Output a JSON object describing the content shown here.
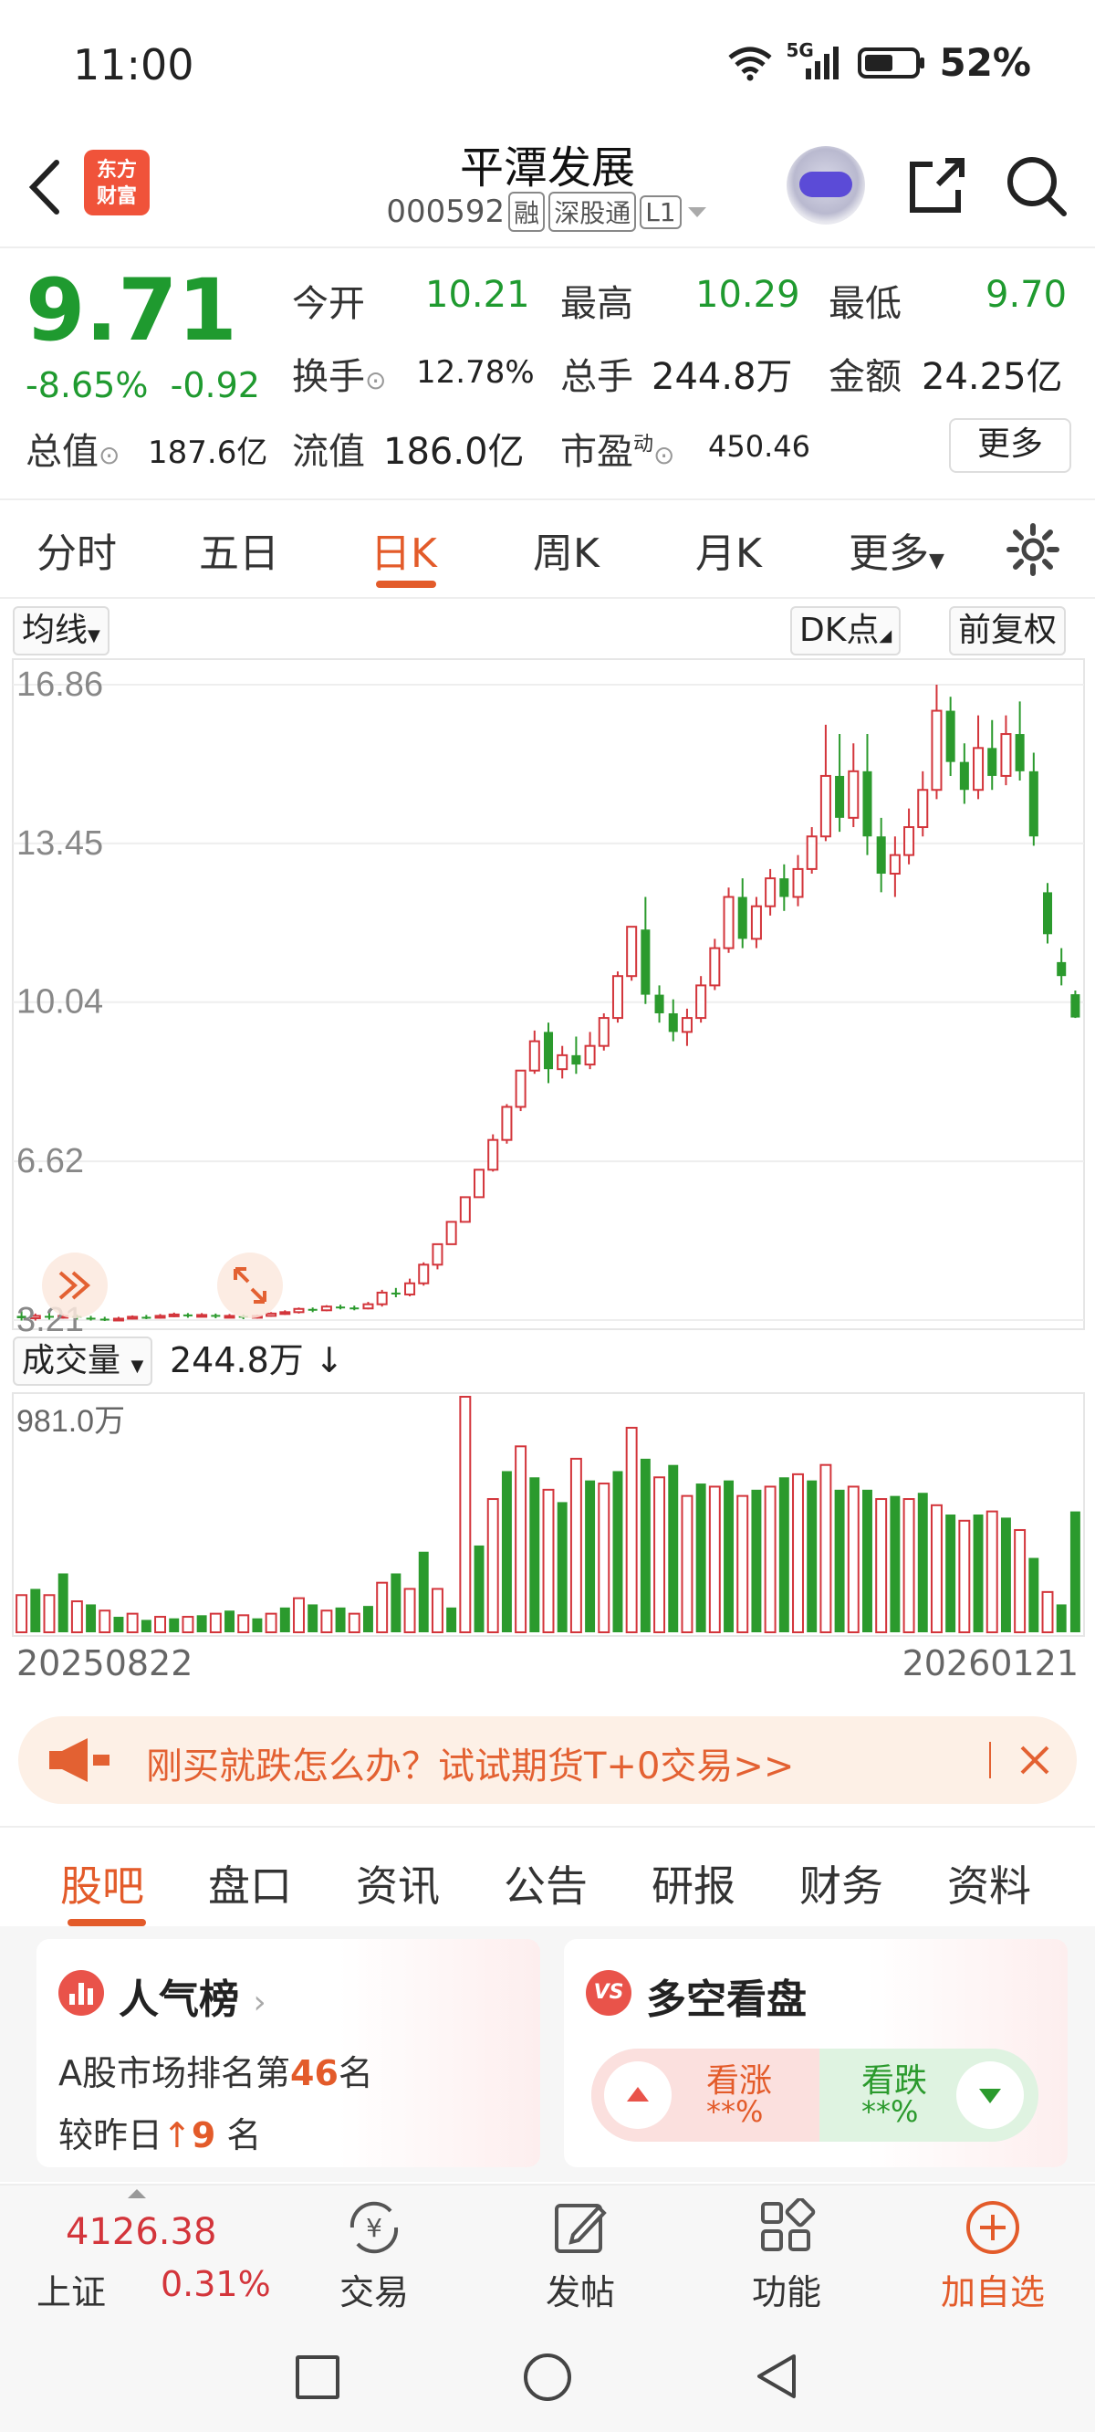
{
  "status_bar": {
    "time": "11:00",
    "network": "5G",
    "battery": "52%"
  },
  "header": {
    "logo_line1": "东方",
    "logo_line2": "财富",
    "title": "平潭发展",
    "code": "000592",
    "tags": [
      "融",
      "深股通",
      "L1"
    ]
  },
  "quote": {
    "price": "9.71",
    "change_pct": "-8.65%",
    "change_abs": "-0.92",
    "open_label": "今开",
    "open": "10.21",
    "high_label": "最高",
    "high": "10.29",
    "low_label": "最低",
    "low": "9.70",
    "turnover_label": "换手",
    "turnover": "12.78%",
    "volume_label": "总手",
    "volume": "244.8万",
    "amount_label": "金额",
    "amount": "24.25亿",
    "mktcap_label": "总值",
    "mktcap": "187.6亿",
    "float_label": "流值",
    "float": "186.0亿",
    "pe_label": "市盈",
    "pe_sup": "动",
    "pe": "450.46",
    "more": "更多"
  },
  "period_tabs": [
    "分时",
    "五日",
    "日K",
    "周K",
    "月K",
    "更多"
  ],
  "active_period": "日K",
  "chart_options": {
    "ma": "均线",
    "dk": "DK点",
    "adjust": "前复权",
    "volume_label": "成交量",
    "volume_value": "244.8万 ↓"
  },
  "colors": {
    "up": "#d3353b",
    "down": "#2b9a2d",
    "accent": "#e35b2a"
  },
  "chart_data": [
    {
      "type": "candlestick",
      "title": "",
      "y_ticks": [
        "16.86",
        "13.45",
        "10.04",
        "6.62",
        "3.21"
      ],
      "ylim": [
        3.21,
        16.86
      ],
      "x_start": "20250822",
      "x_end": "20260121",
      "candles": [
        [
          3.3,
          3.25,
          3.4,
          3.2
        ],
        [
          3.25,
          3.3,
          3.35,
          3.2
        ],
        [
          3.3,
          3.28,
          3.36,
          3.22
        ],
        [
          3.28,
          3.3,
          3.34,
          3.24
        ],
        [
          3.3,
          3.26,
          3.33,
          3.22
        ],
        [
          3.26,
          3.24,
          3.3,
          3.2
        ],
        [
          3.24,
          3.22,
          3.28,
          3.19
        ],
        [
          3.22,
          3.24,
          3.28,
          3.2
        ],
        [
          3.24,
          3.28,
          3.31,
          3.22
        ],
        [
          3.28,
          3.26,
          3.32,
          3.23
        ],
        [
          3.26,
          3.3,
          3.34,
          3.24
        ],
        [
          3.3,
          3.33,
          3.37,
          3.27
        ],
        [
          3.33,
          3.3,
          3.36,
          3.26
        ],
        [
          3.3,
          3.32,
          3.36,
          3.27
        ],
        [
          3.32,
          3.29,
          3.35,
          3.25
        ],
        [
          3.29,
          3.3,
          3.34,
          3.26
        ],
        [
          3.3,
          3.27,
          3.33,
          3.23
        ],
        [
          3.27,
          3.3,
          3.33,
          3.24
        ],
        [
          3.3,
          3.35,
          3.38,
          3.28
        ],
        [
          3.35,
          3.38,
          3.42,
          3.32
        ],
        [
          3.38,
          3.45,
          3.48,
          3.35
        ],
        [
          3.45,
          3.42,
          3.48,
          3.38
        ],
        [
          3.42,
          3.5,
          3.53,
          3.4
        ],
        [
          3.5,
          3.48,
          3.54,
          3.44
        ],
        [
          3.48,
          3.46,
          3.52,
          3.42
        ],
        [
          3.46,
          3.55,
          3.6,
          3.44
        ],
        [
          3.55,
          3.8,
          3.86,
          3.5
        ],
        [
          3.8,
          3.76,
          3.9,
          3.7
        ],
        [
          3.76,
          4.0,
          4.1,
          3.72
        ],
        [
          4.0,
          4.4,
          4.45,
          3.95
        ],
        [
          4.4,
          4.84,
          4.84,
          4.3
        ],
        [
          4.84,
          5.32,
          5.32,
          4.84
        ],
        [
          5.32,
          5.85,
          5.85,
          5.32
        ],
        [
          5.85,
          6.44,
          6.44,
          5.85
        ],
        [
          6.44,
          7.08,
          7.2,
          6.4
        ],
        [
          7.08,
          7.79,
          7.85,
          7.0
        ],
        [
          7.79,
          8.57,
          8.57,
          7.7
        ],
        [
          8.57,
          9.2,
          9.43,
          8.5
        ],
        [
          9.4,
          8.6,
          9.6,
          8.3
        ],
        [
          8.6,
          8.9,
          9.1,
          8.4
        ],
        [
          8.9,
          8.7,
          9.3,
          8.5
        ],
        [
          8.7,
          9.1,
          9.4,
          8.6
        ],
        [
          9.1,
          9.7,
          9.8,
          9.0
        ],
        [
          9.7,
          10.6,
          10.7,
          9.6
        ],
        [
          10.6,
          11.66,
          11.66,
          10.5
        ],
        [
          11.6,
          10.2,
          12.3,
          10.0
        ],
        [
          10.2,
          9.8,
          10.4,
          9.6
        ],
        [
          9.8,
          9.4,
          10.1,
          9.2
        ],
        [
          9.4,
          9.7,
          9.9,
          9.1
        ],
        [
          9.7,
          10.4,
          10.6,
          9.6
        ],
        [
          10.4,
          11.2,
          11.4,
          10.3
        ],
        [
          11.2,
          12.3,
          12.5,
          11.1
        ],
        [
          12.3,
          11.4,
          12.7,
          11.2
        ],
        [
          11.4,
          12.1,
          12.3,
          11.2
        ],
        [
          12.1,
          12.7,
          12.9,
          11.9
        ],
        [
          12.7,
          12.3,
          13.0,
          12.0
        ],
        [
          12.3,
          12.9,
          13.2,
          12.1
        ],
        [
          12.9,
          13.6,
          13.8,
          12.8
        ],
        [
          13.6,
          14.9,
          16.0,
          13.5
        ],
        [
          14.9,
          14.0,
          15.8,
          13.7
        ],
        [
          14.0,
          15.0,
          15.6,
          13.8
        ],
        [
          15.0,
          13.6,
          15.8,
          13.2
        ],
        [
          13.6,
          12.8,
          14.0,
          12.4
        ],
        [
          12.8,
          13.2,
          13.6,
          12.3
        ],
        [
          13.2,
          13.8,
          14.2,
          13.0
        ],
        [
          13.8,
          14.6,
          15.0,
          13.6
        ],
        [
          14.6,
          16.3,
          16.86,
          14.4
        ],
        [
          16.3,
          15.2,
          16.6,
          14.9
        ],
        [
          15.2,
          14.6,
          15.6,
          14.3
        ],
        [
          14.6,
          15.5,
          16.2,
          14.4
        ],
        [
          15.5,
          14.9,
          16.1,
          14.6
        ],
        [
          14.9,
          15.8,
          16.2,
          14.7
        ],
        [
          15.8,
          15.0,
          16.5,
          14.8
        ],
        [
          15.0,
          13.6,
          15.4,
          13.4
        ],
        [
          12.4,
          11.5,
          12.6,
          11.3
        ],
        [
          10.9,
          10.6,
          11.2,
          10.4
        ],
        [
          10.21,
          9.71,
          10.29,
          9.7
        ]
      ],
      "volume_label": "981.0万",
      "volumes": [
        [
          1.2,
          1
        ],
        [
          1.4,
          0
        ],
        [
          1.2,
          1
        ],
        [
          1.9,
          0
        ],
        [
          1.0,
          1
        ],
        [
          0.9,
          0
        ],
        [
          0.7,
          1
        ],
        [
          0.5,
          0
        ],
        [
          0.6,
          1
        ],
        [
          0.4,
          0
        ],
        [
          0.5,
          1
        ],
        [
          0.45,
          0
        ],
        [
          0.5,
          1
        ],
        [
          0.55,
          0
        ],
        [
          0.6,
          1
        ],
        [
          0.7,
          0
        ],
        [
          0.55,
          1
        ],
        [
          0.45,
          0
        ],
        [
          0.6,
          1
        ],
        [
          0.8,
          0
        ],
        [
          1.1,
          1
        ],
        [
          0.9,
          0
        ],
        [
          0.7,
          1
        ],
        [
          0.8,
          0
        ],
        [
          0.6,
          1
        ],
        [
          0.85,
          0
        ],
        [
          1.6,
          1
        ],
        [
          1.9,
          0
        ],
        [
          1.4,
          1
        ],
        [
          2.6,
          0
        ],
        [
          1.4,
          1
        ],
        [
          0.8,
          0
        ],
        [
          7.6,
          1
        ],
        [
          2.8,
          0
        ],
        [
          4.3,
          1
        ],
        [
          5.2,
          0
        ],
        [
          6.0,
          1
        ],
        [
          5.0,
          0
        ],
        [
          4.6,
          1
        ],
        [
          4.2,
          0
        ],
        [
          5.6,
          1
        ],
        [
          4.9,
          0
        ],
        [
          4.8,
          1
        ],
        [
          5.2,
          0
        ],
        [
          6.6,
          1
        ],
        [
          5.6,
          0
        ],
        [
          5.0,
          1
        ],
        [
          5.4,
          0
        ],
        [
          4.4,
          1
        ],
        [
          4.8,
          0
        ],
        [
          4.7,
          1
        ],
        [
          4.9,
          0
        ],
        [
          4.4,
          1
        ],
        [
          4.6,
          0
        ],
        [
          4.7,
          1
        ],
        [
          5.0,
          0
        ],
        [
          5.1,
          1
        ],
        [
          4.9,
          0
        ],
        [
          5.4,
          1
        ],
        [
          4.6,
          0
        ],
        [
          4.7,
          1
        ],
        [
          4.6,
          0
        ],
        [
          4.3,
          1
        ],
        [
          4.4,
          0
        ],
        [
          4.3,
          1
        ],
        [
          4.5,
          0
        ],
        [
          4.1,
          1
        ],
        [
          3.8,
          0
        ],
        [
          3.6,
          1
        ],
        [
          3.8,
          0
        ],
        [
          3.9,
          1
        ],
        [
          3.7,
          0
        ],
        [
          3.3,
          1
        ],
        [
          2.4,
          0
        ],
        [
          1.3,
          1
        ],
        [
          0.9,
          0
        ],
        [
          3.9,
          0
        ]
      ]
    }
  ],
  "promo": {
    "text": "刚买就跌怎么办？试试期货T+0交易>>"
  },
  "section_tabs": [
    "股吧",
    "盘口",
    "资讯",
    "公告",
    "研报",
    "财务",
    "资料"
  ],
  "popularity": {
    "title": "人气榜",
    "rank_prefix": "A股市场排名第",
    "rank": "46",
    "rank_suffix": "名",
    "change_prefix": "较昨日",
    "change": "9",
    "change_suffix": "名"
  },
  "sentiment": {
    "title": "多空看盘",
    "bull_label": "看涨",
    "bull_value": "**%",
    "bear_label": "看跌",
    "bear_value": "**%"
  },
  "index_bar": {
    "value": "4126.38",
    "name": "上证",
    "change": "0.31%"
  },
  "bottom_nav": [
    "交易",
    "发帖",
    "功能",
    "加自选"
  ]
}
